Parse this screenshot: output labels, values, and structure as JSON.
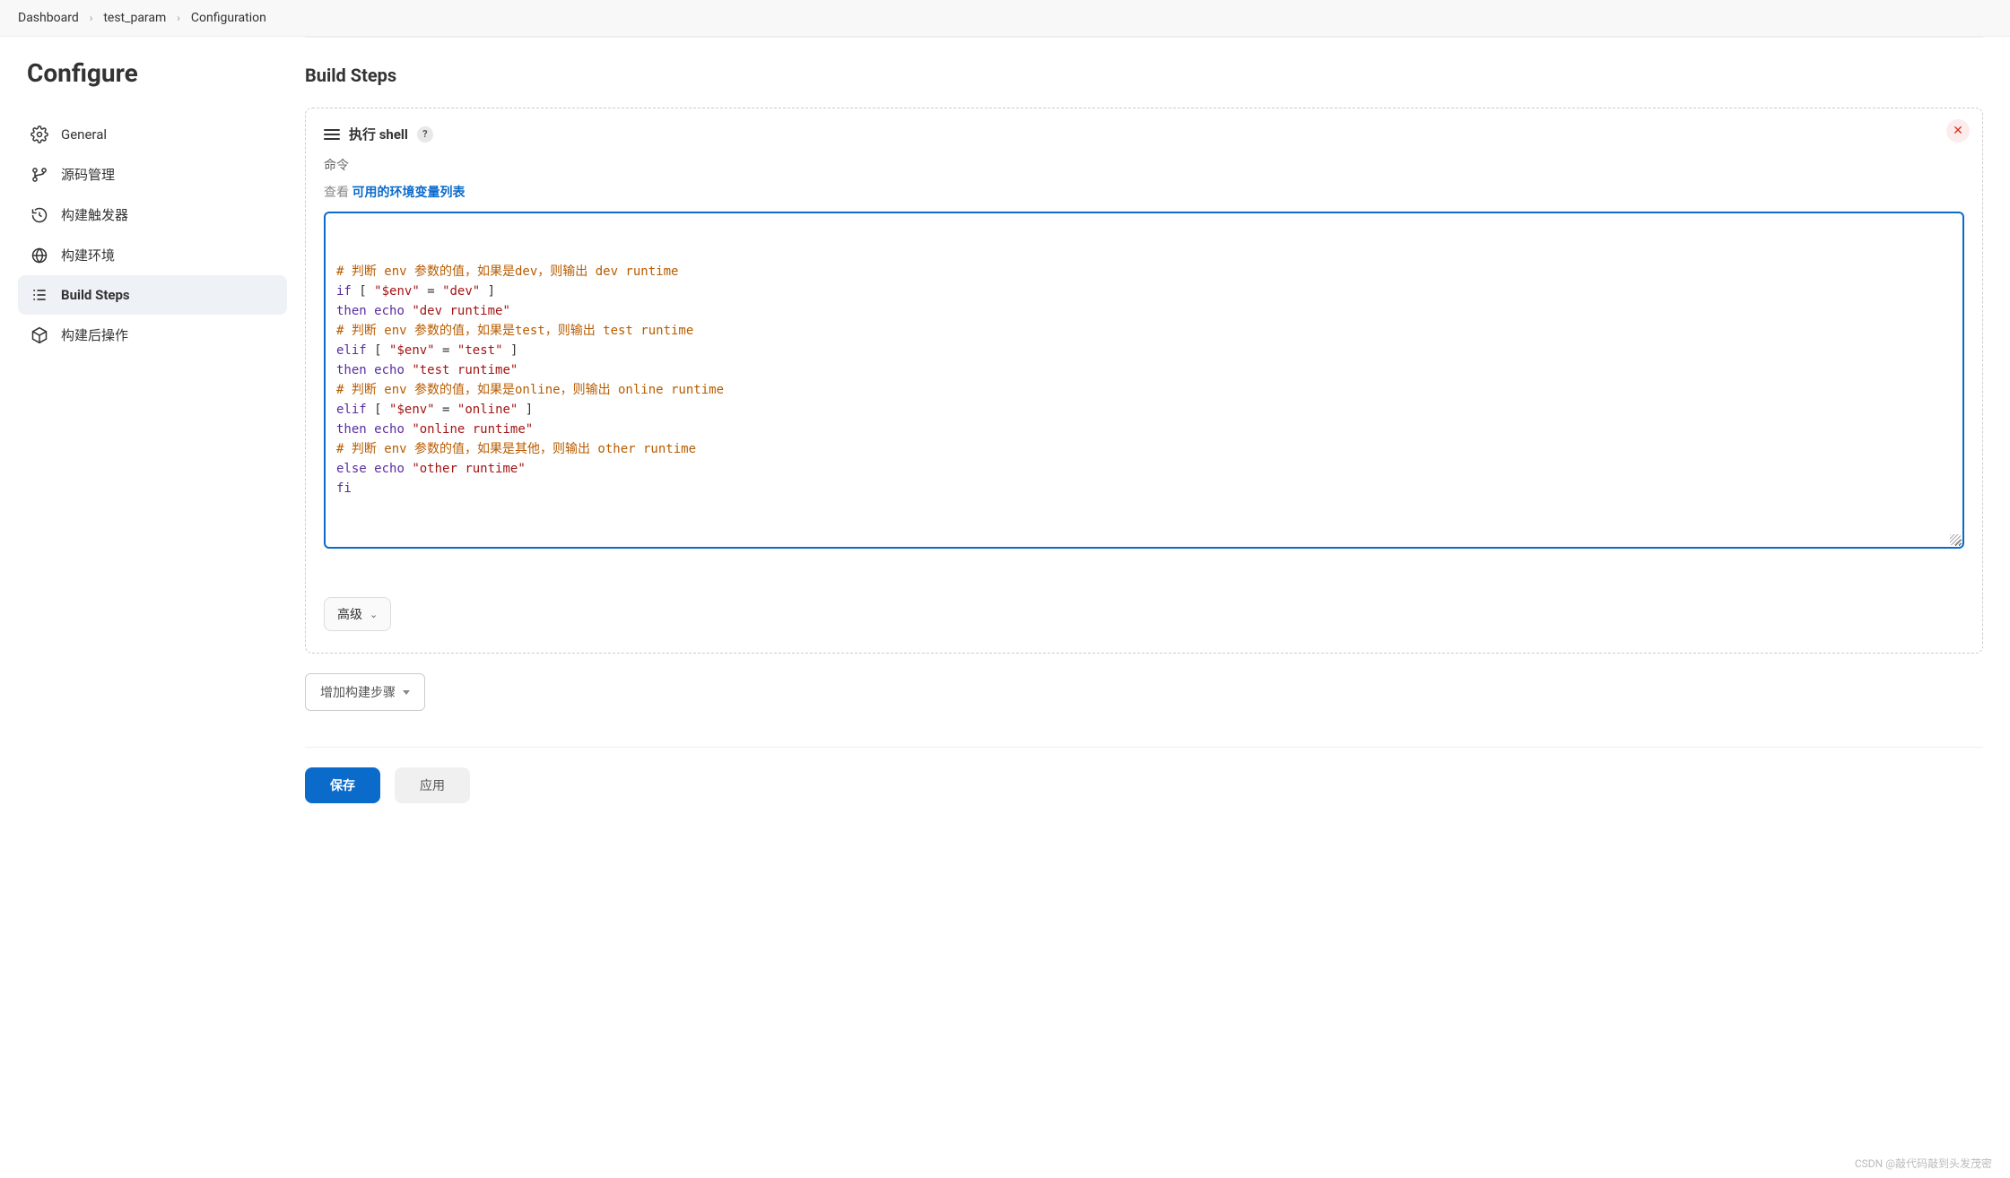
{
  "breadcrumb": {
    "items": [
      "Dashboard",
      "test_param",
      "Configuration"
    ]
  },
  "sidebar": {
    "title": "Configure",
    "items": [
      {
        "label": "General",
        "icon": "gear-icon"
      },
      {
        "label": "源码管理",
        "icon": "branch-icon"
      },
      {
        "label": "构建触发器",
        "icon": "clock-icon"
      },
      {
        "label": "构建环境",
        "icon": "globe-icon"
      },
      {
        "label": "Build Steps",
        "icon": "steps-icon",
        "active": true
      },
      {
        "label": "构建后操作",
        "icon": "cube-icon"
      }
    ]
  },
  "main": {
    "section_title": "Build Steps",
    "step": {
      "title": "执行 shell",
      "help": "?",
      "command_label": "命令",
      "see_prefix": "查看 ",
      "see_link": "可用的环境变量列表",
      "code_lines": [
        {
          "t": "comment",
          "text": "# 判断 env 参数的值，如果是dev，则输出 dev runtime"
        },
        {
          "t": "code",
          "tokens": [
            [
              "kw",
              "if"
            ],
            [
              "sp",
              " "
            ],
            [
              "op",
              "["
            ],
            [
              "sp",
              " "
            ],
            [
              "str",
              "\"$env\""
            ],
            [
              "sp",
              " "
            ],
            [
              "op",
              "="
            ],
            [
              "sp",
              " "
            ],
            [
              "str",
              "\"dev\""
            ],
            [
              "sp",
              " "
            ],
            [
              "op",
              "]"
            ]
          ]
        },
        {
          "t": "code",
          "tokens": [
            [
              "kw",
              "then"
            ],
            [
              "sp",
              " "
            ],
            [
              "kw",
              "echo"
            ],
            [
              "sp",
              " "
            ],
            [
              "str",
              "\"dev runtime\""
            ]
          ]
        },
        {
          "t": "comment",
          "text": "# 判断 env 参数的值，如果是test，则输出 test runtime"
        },
        {
          "t": "code",
          "tokens": [
            [
              "kw",
              "elif"
            ],
            [
              "sp",
              " "
            ],
            [
              "op",
              "["
            ],
            [
              "sp",
              " "
            ],
            [
              "str",
              "\"$env\""
            ],
            [
              "sp",
              " "
            ],
            [
              "op",
              "="
            ],
            [
              "sp",
              " "
            ],
            [
              "str",
              "\"test\""
            ],
            [
              "sp",
              " "
            ],
            [
              "op",
              "]"
            ]
          ]
        },
        {
          "t": "code",
          "tokens": [
            [
              "kw",
              "then"
            ],
            [
              "sp",
              " "
            ],
            [
              "kw",
              "echo"
            ],
            [
              "sp",
              " "
            ],
            [
              "str",
              "\"test runtime\""
            ]
          ]
        },
        {
          "t": "comment",
          "text": "# 判断 env 参数的值，如果是online，则输出 online runtime"
        },
        {
          "t": "code",
          "tokens": [
            [
              "kw",
              "elif"
            ],
            [
              "sp",
              " "
            ],
            [
              "op",
              "["
            ],
            [
              "sp",
              " "
            ],
            [
              "str",
              "\"$env\""
            ],
            [
              "sp",
              " "
            ],
            [
              "op",
              "="
            ],
            [
              "sp",
              " "
            ],
            [
              "str",
              "\"online\""
            ],
            [
              "sp",
              " "
            ],
            [
              "op",
              "]"
            ]
          ]
        },
        {
          "t": "code",
          "tokens": [
            [
              "kw",
              "then"
            ],
            [
              "sp",
              " "
            ],
            [
              "kw",
              "echo"
            ],
            [
              "sp",
              " "
            ],
            [
              "str",
              "\"online runtime\""
            ]
          ]
        },
        {
          "t": "comment",
          "text": "# 判断 env 参数的值，如果是其他，则输出 other runtime"
        },
        {
          "t": "code",
          "tokens": [
            [
              "kw",
              "else"
            ],
            [
              "sp",
              " "
            ],
            [
              "kw",
              "echo"
            ],
            [
              "sp",
              " "
            ],
            [
              "str",
              "\"other runtime\""
            ]
          ]
        },
        {
          "t": "code",
          "tokens": [
            [
              "kw",
              "fi"
            ]
          ]
        }
      ],
      "advanced_label": "高级"
    },
    "add_step_label": "增加构建步骤",
    "save_label": "保存",
    "apply_label": "应用"
  },
  "watermark": "CSDN @敲代码敲到头发茂密"
}
